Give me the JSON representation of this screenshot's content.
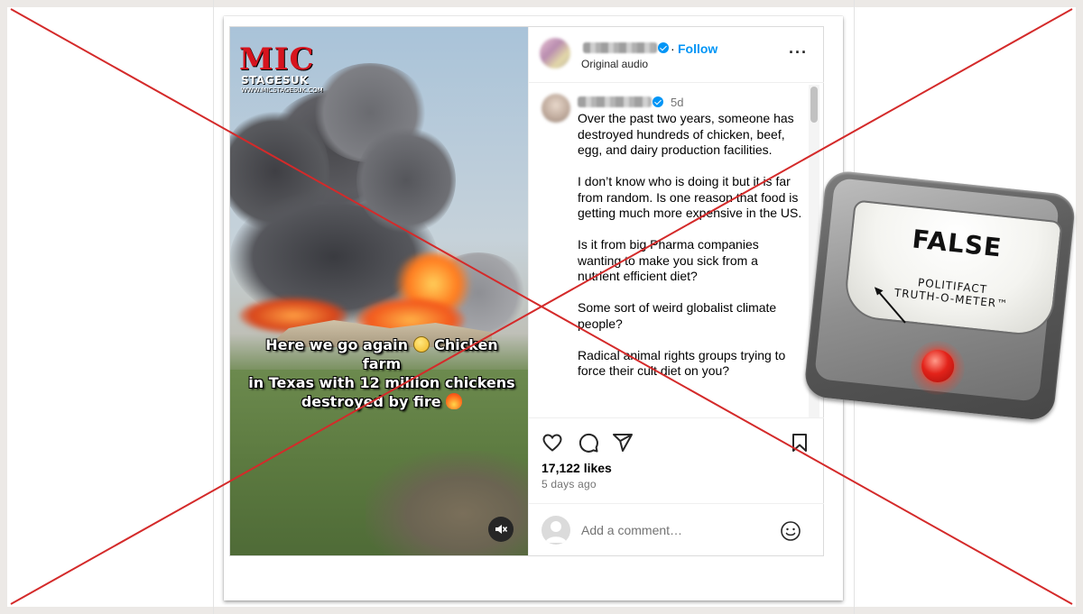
{
  "video": {
    "logo_main": "MIC",
    "logo_sub": "STAGESUK",
    "logo_url": "WWW.MICSTAGESUK.COM",
    "caption_line1_a": "Here we go again",
    "caption_line1_b": "Chicken farm",
    "caption_line2": "in Texas with 12 million chickens",
    "caption_line3": "destroyed by fire"
  },
  "header": {
    "separator": "·",
    "follow_label": "Follow",
    "audio_label": "Original audio",
    "more_label": "···"
  },
  "comment": {
    "time": "5d",
    "paragraphs": [
      "Over the past two years, someone has destroyed hundreds of chicken, beef, egg, and dairy production facilities.",
      "I don’t know who is doing it but it is far from random. Is one reason that food is getting much more expensive in the US.",
      "Is it from big Pharma companies wanting to make you sick from a nutrient efficient diet?",
      "Some sort of weird globalist climate people?",
      "Radical animal rights groups trying to force their cult diet on you?"
    ]
  },
  "engagement": {
    "likes": "17,122 likes",
    "age": "5 days ago"
  },
  "add_comment": {
    "placeholder": "Add a comment…"
  },
  "meter": {
    "verdict": "FALSE",
    "brand_line1": "POLITIFACT",
    "brand_line2": "TRUTH-O-METER™"
  },
  "colors": {
    "accent": "#0095f6",
    "x_mark": "#d42a2a",
    "meter_light": "#e3231a"
  },
  "icons": [
    "heart-icon",
    "comment-icon",
    "share-icon",
    "bookmark-icon",
    "mute-icon",
    "smiley-icon",
    "verified-badge-icon",
    "more-options-icon"
  ]
}
